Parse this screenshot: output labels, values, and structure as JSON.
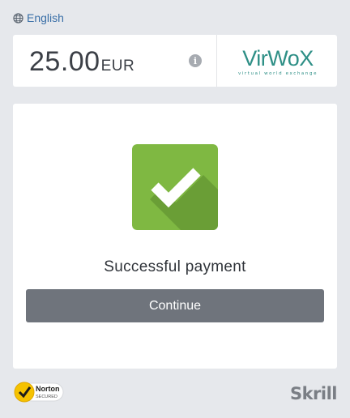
{
  "language": {
    "label": "English",
    "icon": "globe-icon"
  },
  "amount": {
    "value": "25.00",
    "currency": "EUR"
  },
  "merchant": {
    "name": "VirWoX",
    "tagline": "virtual world exchange",
    "color": "#2e8f86"
  },
  "status": {
    "icon": "checkmark-icon",
    "text": "Successful payment",
    "color": "#7fb842"
  },
  "actions": {
    "continue_label": "Continue"
  },
  "footer": {
    "norton_line1": "Norton",
    "norton_line2": "SECURED",
    "brand": "Skrill"
  }
}
